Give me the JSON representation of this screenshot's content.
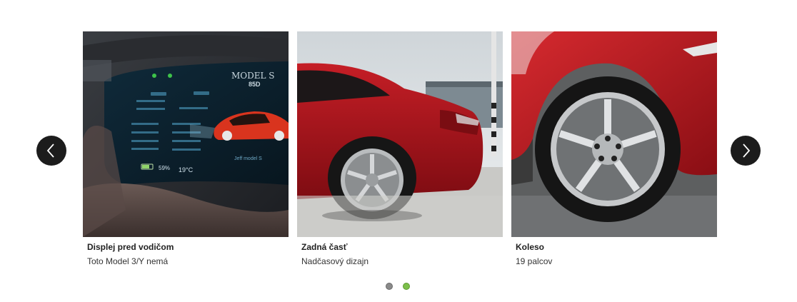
{
  "carousel": {
    "slides": [
      {
        "title": "Displej pred vodičom",
        "subtitle": "Toto Model 3/Y nemá",
        "image": "dashboard-display-photo"
      },
      {
        "title": "Zadná časť",
        "subtitle": "Nadčasový dizajn",
        "image": "rear-car-photo"
      },
      {
        "title": "Koleso",
        "subtitle": "19 palcov",
        "image": "wheel-photo"
      }
    ],
    "display": {
      "model_text": "MODEL S",
      "variant_text": "85D",
      "owner_text": "Jeff model S",
      "battery_text": "59%",
      "temp_text": "19°C"
    },
    "controls": {
      "prev_icon": "chevron-left-icon",
      "next_icon": "chevron-right-icon"
    },
    "pagination": {
      "count": 2,
      "active_index": 1
    },
    "colors": {
      "arrow_bg": "#1c1c1c",
      "dot_inactive": "#8a8a8a",
      "dot_active": "#7cbf4a",
      "car_red": "#b3141b"
    }
  }
}
